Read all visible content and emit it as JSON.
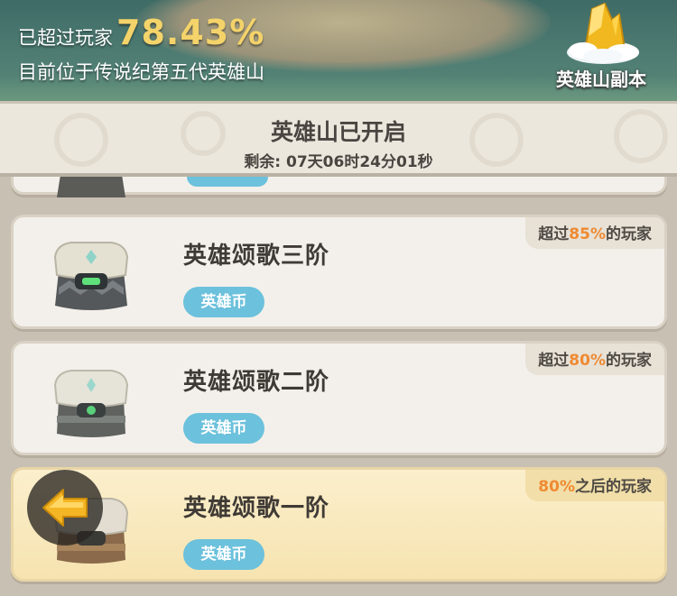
{
  "banner": {
    "rank_prefix": "已超过玩家",
    "rank_percent": "78.43%",
    "position_text": "目前位于传说纪第五代英雄山",
    "dungeon_label": "英雄山副本"
  },
  "status": {
    "title": "英雄山已开启",
    "remaining": "剩余: 07天06时24分01秒"
  },
  "tiers": [
    {
      "name": "英雄颂歌三阶",
      "coin_label": "英雄币",
      "tag_pre": "超过",
      "tag_num": "85%",
      "tag_post": "的玩家",
      "chest": "grey-stone-chest"
    },
    {
      "name": "英雄颂歌二阶",
      "coin_label": "英雄币",
      "tag_pre": "超过",
      "tag_num": "80%",
      "tag_post": "的玩家",
      "chest": "grey-stone-chest"
    },
    {
      "name": "英雄颂歌一阶",
      "coin_label": "英雄币",
      "tag_pre": "",
      "tag_num": "80%",
      "tag_post": "之后的玩家",
      "chest": "brown-stone-chest"
    }
  ],
  "icons": {
    "dungeon": "gold-mountain-icon",
    "back": "back-arrow-icon"
  },
  "colors": {
    "accent_gold": "#f4d36a",
    "percent_orange": "#ef8a32",
    "coin_blue": "#6cc1dc"
  }
}
